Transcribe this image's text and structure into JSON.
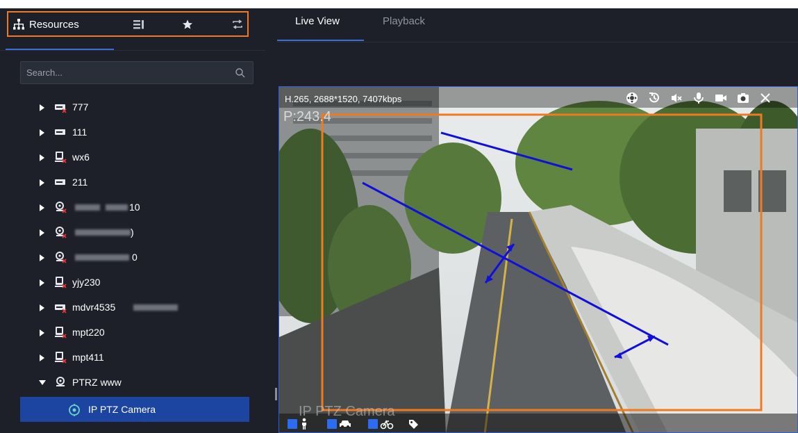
{
  "resources_panel": {
    "tab_label": "Resources",
    "search_placeholder": "Search...",
    "tree": [
      {
        "label": "777",
        "icon": "nvr-offline-icon",
        "expanded": false
      },
      {
        "label": "111",
        "icon": "nvr-icon",
        "expanded": false
      },
      {
        "label": "wx6",
        "icon": "encoder-offline-icon",
        "expanded": false
      },
      {
        "label": "211",
        "icon": "nvr-icon",
        "expanded": false
      },
      {
        "label": "10",
        "icon": "camera-group-offline-icon",
        "expanded": false,
        "blurred_prefix": true
      },
      {
        "label": ")",
        "icon": "camera-group-offline-icon",
        "expanded": false,
        "blurred_prefix": true
      },
      {
        "label": "0",
        "icon": "camera-group-offline-icon",
        "expanded": false,
        "blurred_prefix": true
      },
      {
        "label": "yjy230",
        "icon": "encoder-offline-icon",
        "expanded": false
      },
      {
        "label": "mdvr4535",
        "icon": "nvr-offline-icon",
        "expanded": false,
        "blurred_suffix": true
      },
      {
        "label": "mpt220",
        "icon": "encoder-offline-icon",
        "expanded": false
      },
      {
        "label": "mpt411",
        "icon": "encoder-offline-icon",
        "expanded": false
      },
      {
        "label": "PTRZ www",
        "icon": "camera-group-icon",
        "expanded": true
      }
    ],
    "selected_item": {
      "label": "IP PTZ Camera",
      "icon": "ptz-camera-icon"
    }
  },
  "view_tabs": [
    {
      "label": "Live View",
      "active": true
    },
    {
      "label": "Playback",
      "active": false
    }
  ],
  "video": {
    "codec_info": "H.265, 2688*1520, 7407kbps",
    "ptz_overlay": "P:243.4",
    "camera_label": "IP PTZ Camera",
    "toolbar_icons": [
      "ptz-icon",
      "playback-icon",
      "mute-icon",
      "microphone-icon",
      "record-icon",
      "snapshot-icon",
      "close-icon"
    ],
    "filters": [
      "person-filter",
      "vehicle-filter",
      "bike-filter",
      "tag-icon"
    ]
  },
  "colors": {
    "accent": "#3a6fd8",
    "highlight_box": "#f07a22",
    "selected_row": "#1b45a0",
    "annotation_line": "#1010d8"
  }
}
